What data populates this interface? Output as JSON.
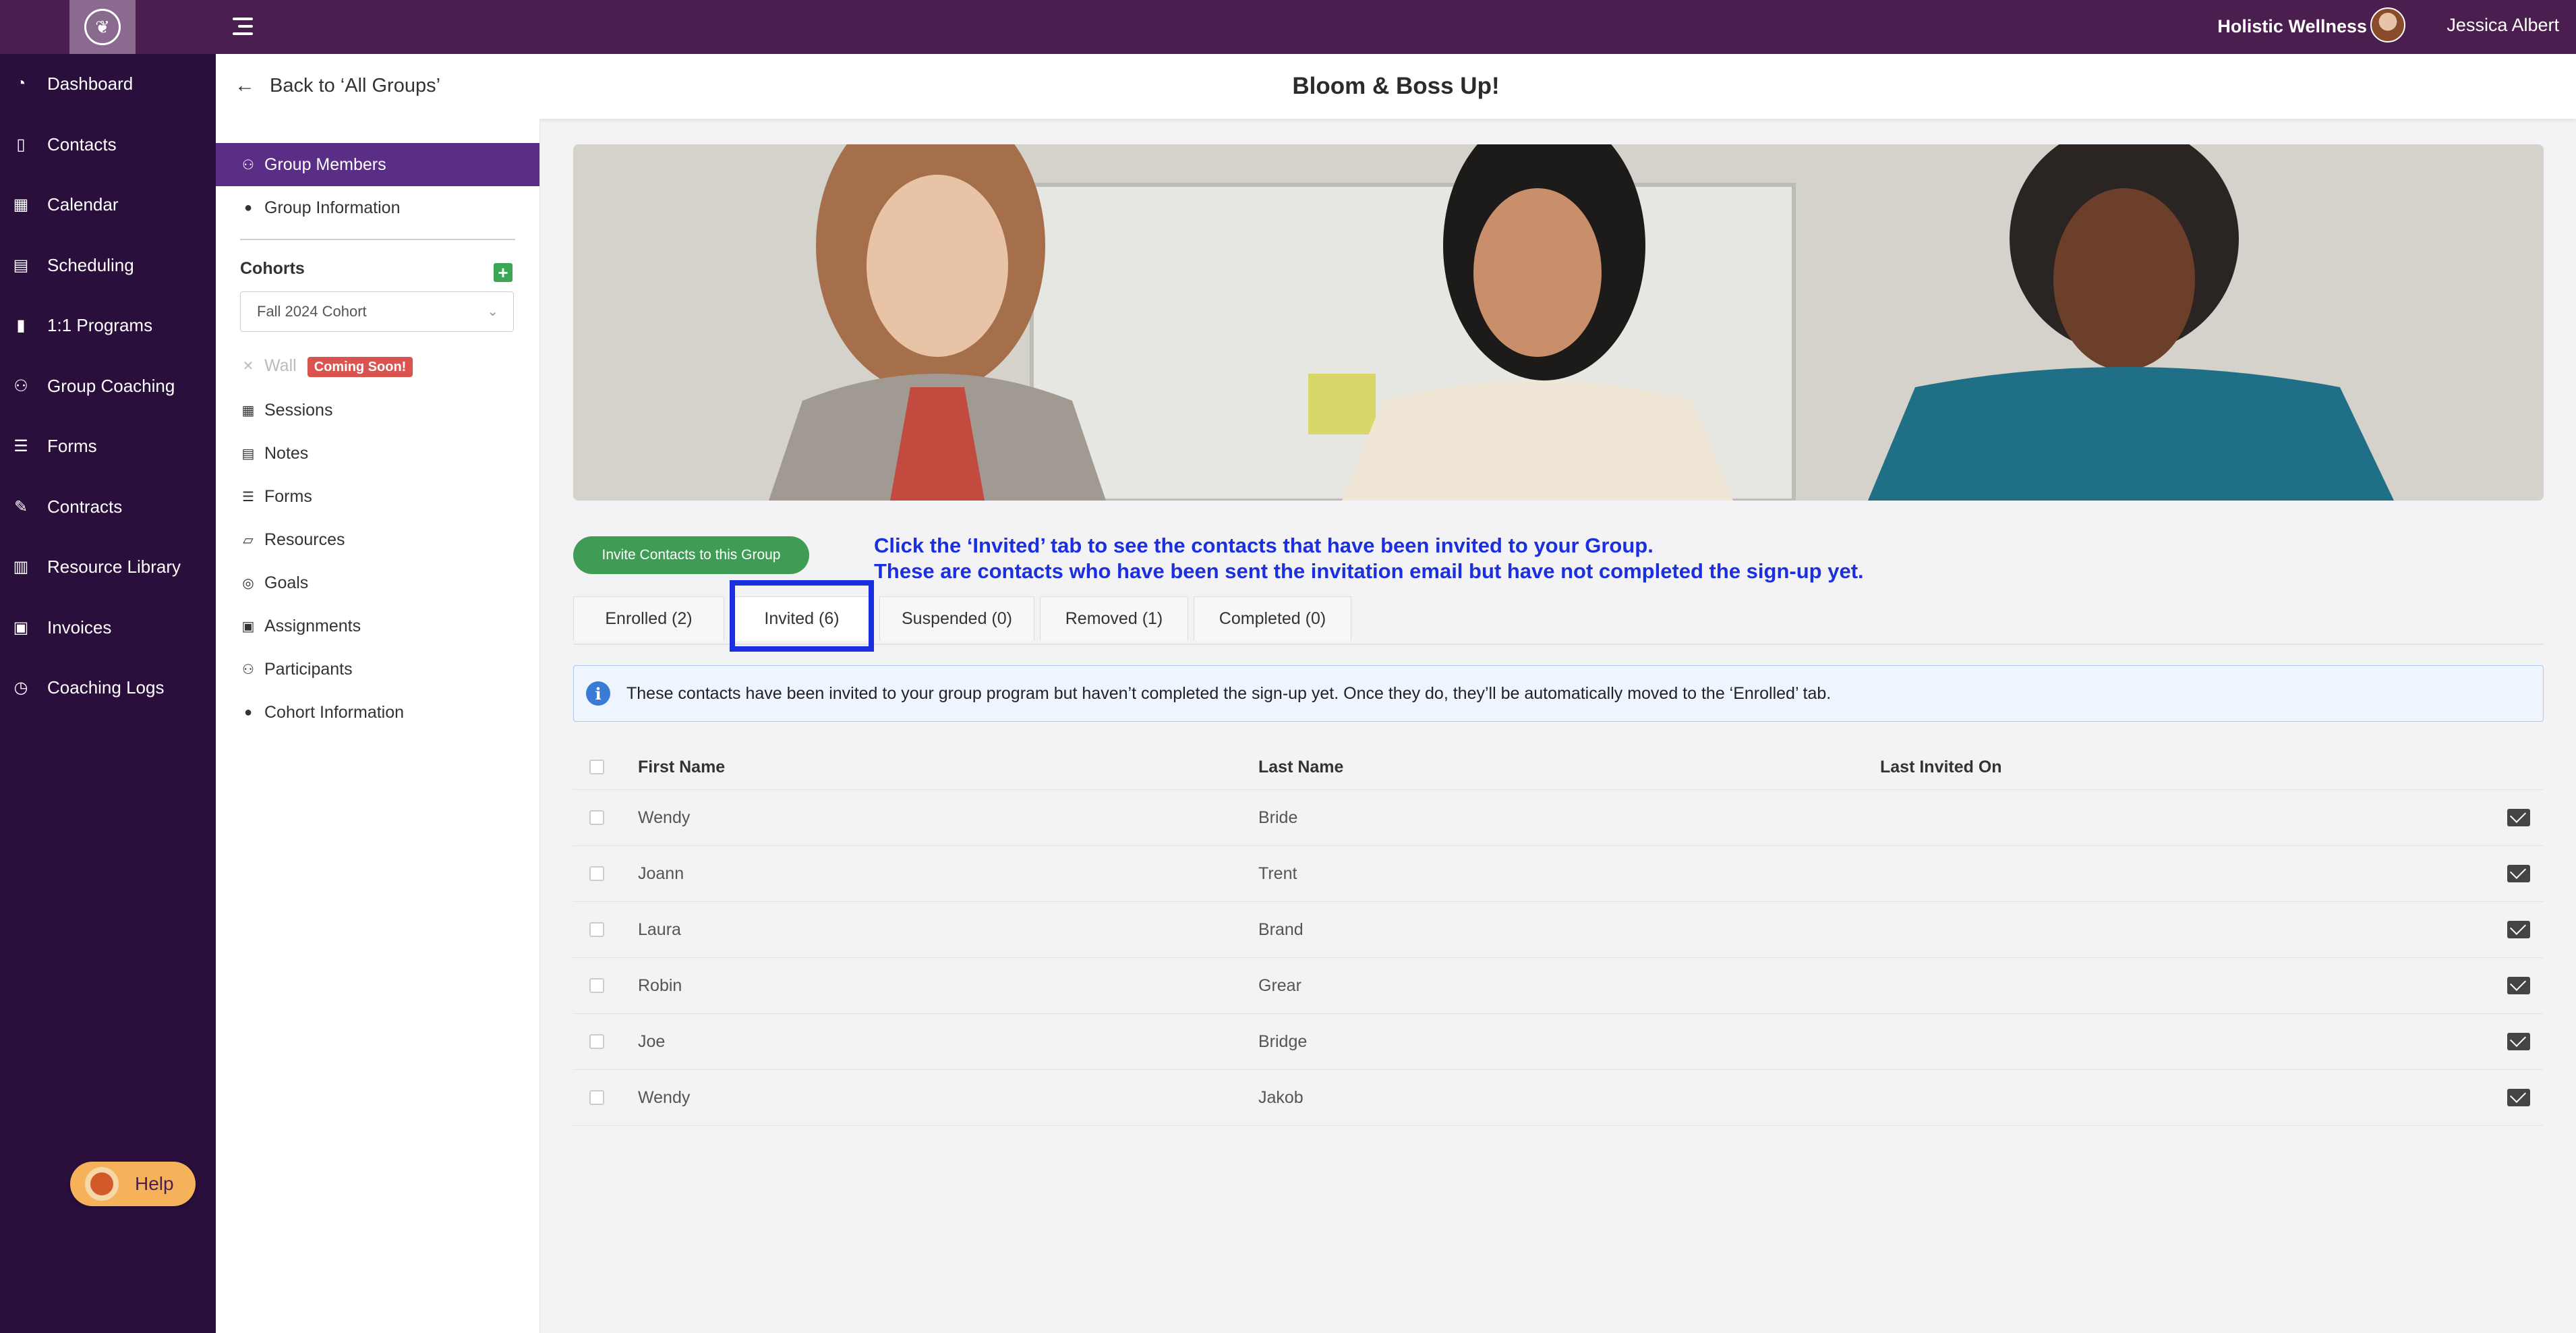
{
  "topbar": {
    "org_name": "Holistic Wellness",
    "user_name": "Jessica Albert",
    "brand_color": "#4a1f4f"
  },
  "sidebar": {
    "items": [
      {
        "label": "Dashboard",
        "icon": "dashboard-icon"
      },
      {
        "label": "Contacts",
        "icon": "contacts-icon"
      },
      {
        "label": "Calendar",
        "icon": "calendar-icon"
      },
      {
        "label": "Scheduling",
        "icon": "scheduling-icon"
      },
      {
        "label": "1:1 Programs",
        "icon": "book-icon"
      },
      {
        "label": "Group Coaching",
        "icon": "group-icon"
      },
      {
        "label": "Forms",
        "icon": "forms-icon"
      },
      {
        "label": "Contracts",
        "icon": "contract-icon"
      },
      {
        "label": "Resource Library",
        "icon": "library-icon"
      },
      {
        "label": "Invoices",
        "icon": "invoice-icon"
      },
      {
        "label": "Coaching Logs",
        "icon": "clock-icon"
      }
    ],
    "help_label": "Help"
  },
  "header": {
    "back_label": "Back to ‘All Groups’",
    "title": "Bloom & Boss Up!"
  },
  "subnav": {
    "top_items": [
      {
        "label": "Group Members",
        "icon": "members-icon",
        "active": true
      },
      {
        "label": "Group Information",
        "icon": "info-icon",
        "active": false
      }
    ],
    "cohorts_label": "Cohorts",
    "cohort_selected": "Fall 2024 Cohort",
    "wall_label": "Wall",
    "wall_badge": "Coming Soon!",
    "cohort_items": [
      {
        "label": "Sessions",
        "icon": "calendar-icon"
      },
      {
        "label": "Notes",
        "icon": "notes-icon"
      },
      {
        "label": "Forms",
        "icon": "forms-icon"
      },
      {
        "label": "Resources",
        "icon": "resources-icon"
      },
      {
        "label": "Goals",
        "icon": "target-icon"
      },
      {
        "label": "Assignments",
        "icon": "clipboard-icon"
      },
      {
        "label": "Participants",
        "icon": "members-icon"
      },
      {
        "label": "Cohort Information",
        "icon": "info-icon"
      }
    ]
  },
  "main": {
    "invite_button": "Invite Contacts to this Group",
    "annotation_line1": "Click the ‘Invited’ tab to see the contacts that have been invited to your Group.",
    "annotation_line2": "These are contacts who have been sent the invitation email but have not completed the sign-up yet.",
    "tabs": [
      {
        "label": "Enrolled (2)"
      },
      {
        "label": "Invited (6)"
      },
      {
        "label": "Suspended (0)"
      },
      {
        "label": "Removed (1)"
      },
      {
        "label": "Completed (0)"
      }
    ],
    "active_tab": "Invited (6)",
    "info_text": "These contacts have been invited to your group program but haven’t completed the sign-up yet. Once they do, they’ll be automatically moved to the ‘Enrolled’ tab.",
    "table": {
      "headers": [
        "First Name",
        "Last Name",
        "Last Invited On"
      ],
      "rows": [
        {
          "first": "Wendy",
          "last": "Bride",
          "invited": ""
        },
        {
          "first": "Joann",
          "last": "Trent",
          "invited": ""
        },
        {
          "first": "Laura",
          "last": "Brand",
          "invited": ""
        },
        {
          "first": "Robin",
          "last": "Grear",
          "invited": ""
        },
        {
          "first": "Joe",
          "last": "Bridge",
          "invited": ""
        },
        {
          "first": "Wendy",
          "last": "Jakob",
          "invited": ""
        }
      ]
    }
  }
}
